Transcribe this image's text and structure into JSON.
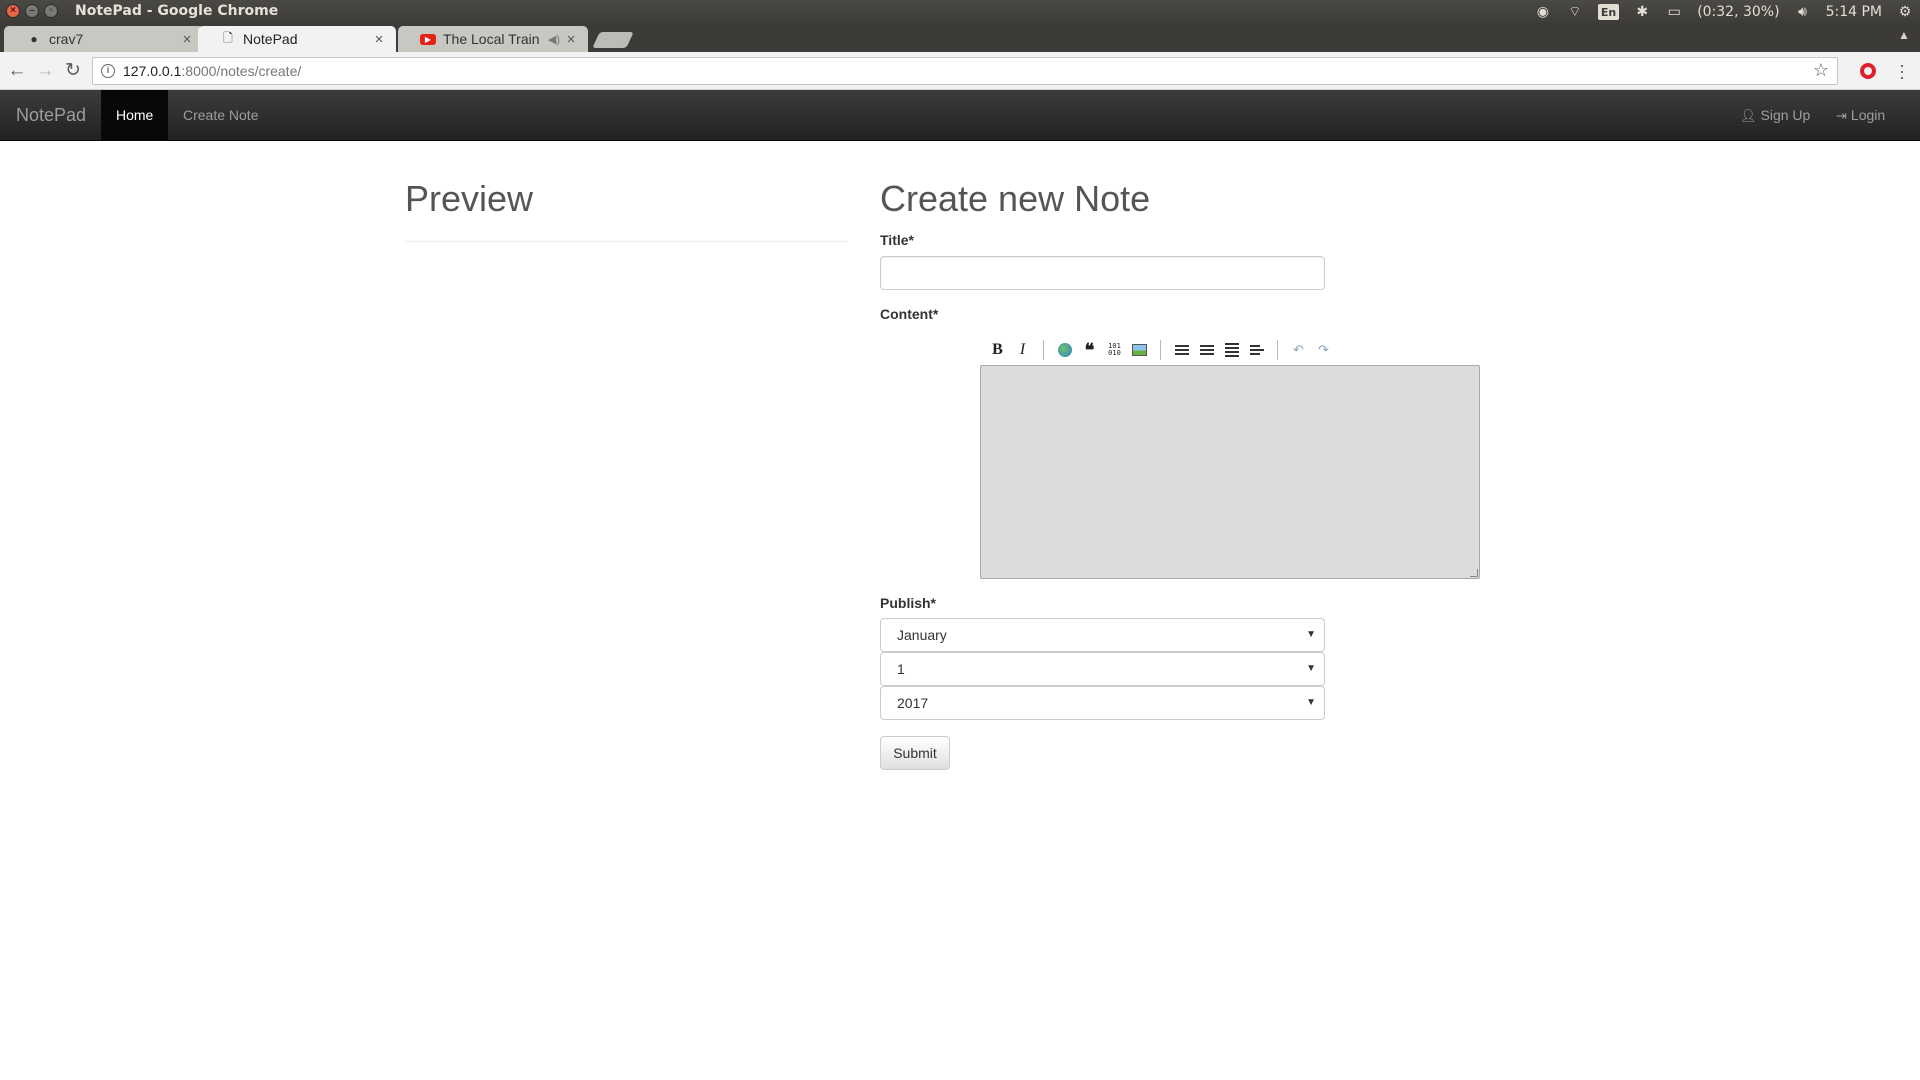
{
  "os": {
    "window_title": "NotePad - Google Chrome",
    "tray_lang": "En",
    "battery": "(0:32, 30%)",
    "clock": "5:14 PM"
  },
  "tabs": [
    {
      "label": "crav7",
      "icon": "github-icon"
    },
    {
      "label": "NotePad",
      "icon": "page-icon"
    },
    {
      "label": "The Local Train - ",
      "icon": "youtube-icon"
    }
  ],
  "address": {
    "host": "127.0.0.1",
    "path": ":8000/notes/create/"
  },
  "navbar": {
    "brand": "NotePad",
    "home": "Home",
    "create_note": "Create Note",
    "sign_up": "Sign Up",
    "login": "Login"
  },
  "preview": {
    "title": "Preview"
  },
  "form": {
    "title": "Create new Note",
    "title_label": "Title*",
    "title_value": "",
    "content_label": "Content*",
    "publish_label": "Publish*",
    "month": "January",
    "day": "1",
    "year": "2017",
    "submit": "Submit"
  },
  "colors": {
    "navbar_bg": "#222222",
    "navbar_active": "#080808",
    "editor_bg": "#dcdcdc",
    "heading": "#555555"
  }
}
